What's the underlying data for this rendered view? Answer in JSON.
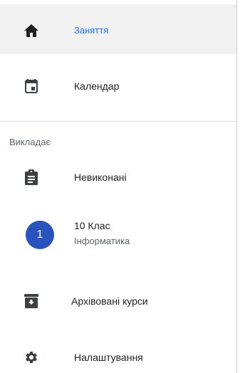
{
  "drawer": {
    "items": [
      {
        "label": "Заняття",
        "icon": "home-icon",
        "active": true
      },
      {
        "label": "Календар",
        "icon": "calendar-icon",
        "active": false
      }
    ],
    "section": {
      "heading": "Викладає",
      "items": [
        {
          "label": "Невиконані",
          "icon": "assignment-icon"
        }
      ],
      "classes": [
        {
          "avatar": "1",
          "title": "10 Клас",
          "subtitle": "Інформатика",
          "avatar_color": "#2a52be"
        }
      ]
    },
    "bottom_items": [
      {
        "label": "Архівовані курси",
        "icon": "archive-icon"
      },
      {
        "label": "Налаштування",
        "icon": "gear-icon"
      }
    ]
  },
  "colors": {
    "accent": "#1a73e8",
    "active_bg": "#f1f1f1",
    "icon": "#3c4043"
  }
}
